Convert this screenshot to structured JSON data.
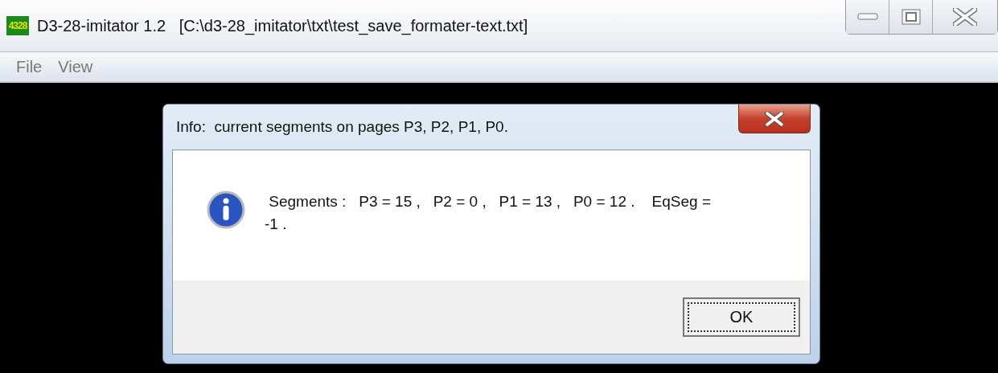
{
  "window": {
    "icon_text": "4328",
    "title": "D3-28-imitator 1.2   [C:\\d3-28_imitator\\txt\\test_save_formater-text.txt]"
  },
  "menu": [
    {
      "label": "File"
    },
    {
      "label": "View"
    }
  ],
  "dialog": {
    "title": "Info:  current segments on pages P3, P2, P1, P0.",
    "message": " Segments :   P3 = 15 ,   P2 = 0 ,   P1 = 13 ,   P0 = 12 .    EqSeg = -1 .",
    "buttons": [
      {
        "label": "OK",
        "selected": true
      }
    ]
  }
}
